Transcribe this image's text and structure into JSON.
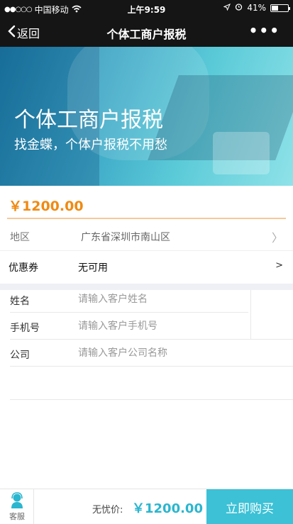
{
  "status_bar": {
    "signal_dots": "●●○○○",
    "carrier": "中国移动",
    "wifi_icon": "wifi-icon",
    "time": "上午9:59",
    "battery_percent": "41%",
    "battery_level": 0.41
  },
  "nav": {
    "back_label": "返回",
    "title": "个体工商户报税",
    "more_label": "•••"
  },
  "banner": {
    "title": "个体工商户报税",
    "subtitle": "找金蝶，个体户报税不用愁"
  },
  "price": "￥1200.00",
  "region": {
    "label": "地区",
    "value": "广东省深圳市南山区",
    "chevron": "〉"
  },
  "coupon": {
    "label": "优惠券",
    "value": "无可用",
    "chevron": ">"
  },
  "form": {
    "name": {
      "label": "姓名",
      "placeholder": "请输入客户姓名"
    },
    "phone": {
      "label": "手机号",
      "placeholder": "请输入客户手机号"
    },
    "company": {
      "label": "公司",
      "placeholder": "请输入客户公司名称"
    }
  },
  "bottom": {
    "service_label": "客服",
    "total_label": "无忧价:",
    "total_price": "￥1200.00",
    "buy_label": "立即购买"
  },
  "colors": {
    "accent_orange": "#f08a12",
    "accent_teal": "#3cc1d6",
    "nav_bg": "#151515"
  }
}
